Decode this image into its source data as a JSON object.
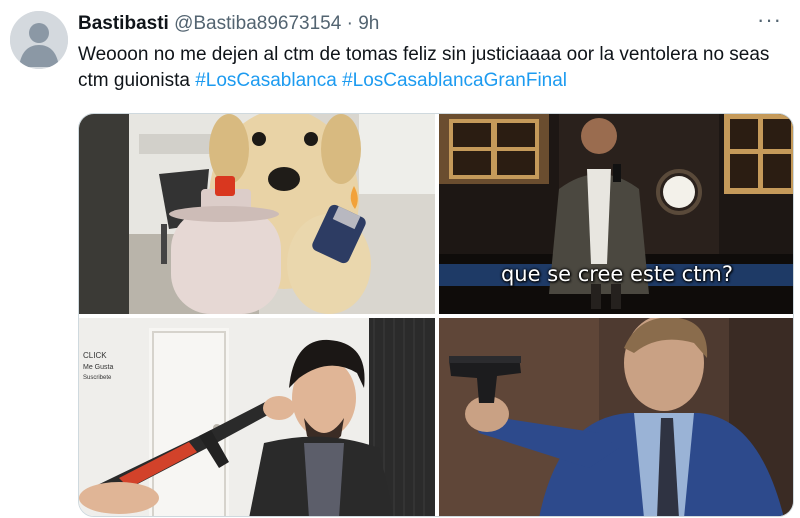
{
  "tweet": {
    "author_name": "Bastibasti",
    "author_handle": "@Bastiba89673154",
    "separator": "·",
    "time": "9h",
    "more_label": "···",
    "text": "Weooon no me dejen al ctm de tomas feliz sin justiciaaaa oor la ventolera no seas ctm guionista ",
    "hashtags": [
      "#LosCasablanca",
      "#LosCasablancaGranFinal"
    ]
  },
  "media": {
    "images": [
      {
        "caption": ""
      },
      {
        "caption": "que se cree este ctm?"
      },
      {
        "sign_text": [
          "CLICK",
          "Me Gusta",
          "Suscribete"
        ]
      },
      {
        "caption": ""
      }
    ]
  },
  "colors": {
    "link": "#1d9bf0",
    "secondary_text": "#536471",
    "border": "#cfd9de"
  }
}
